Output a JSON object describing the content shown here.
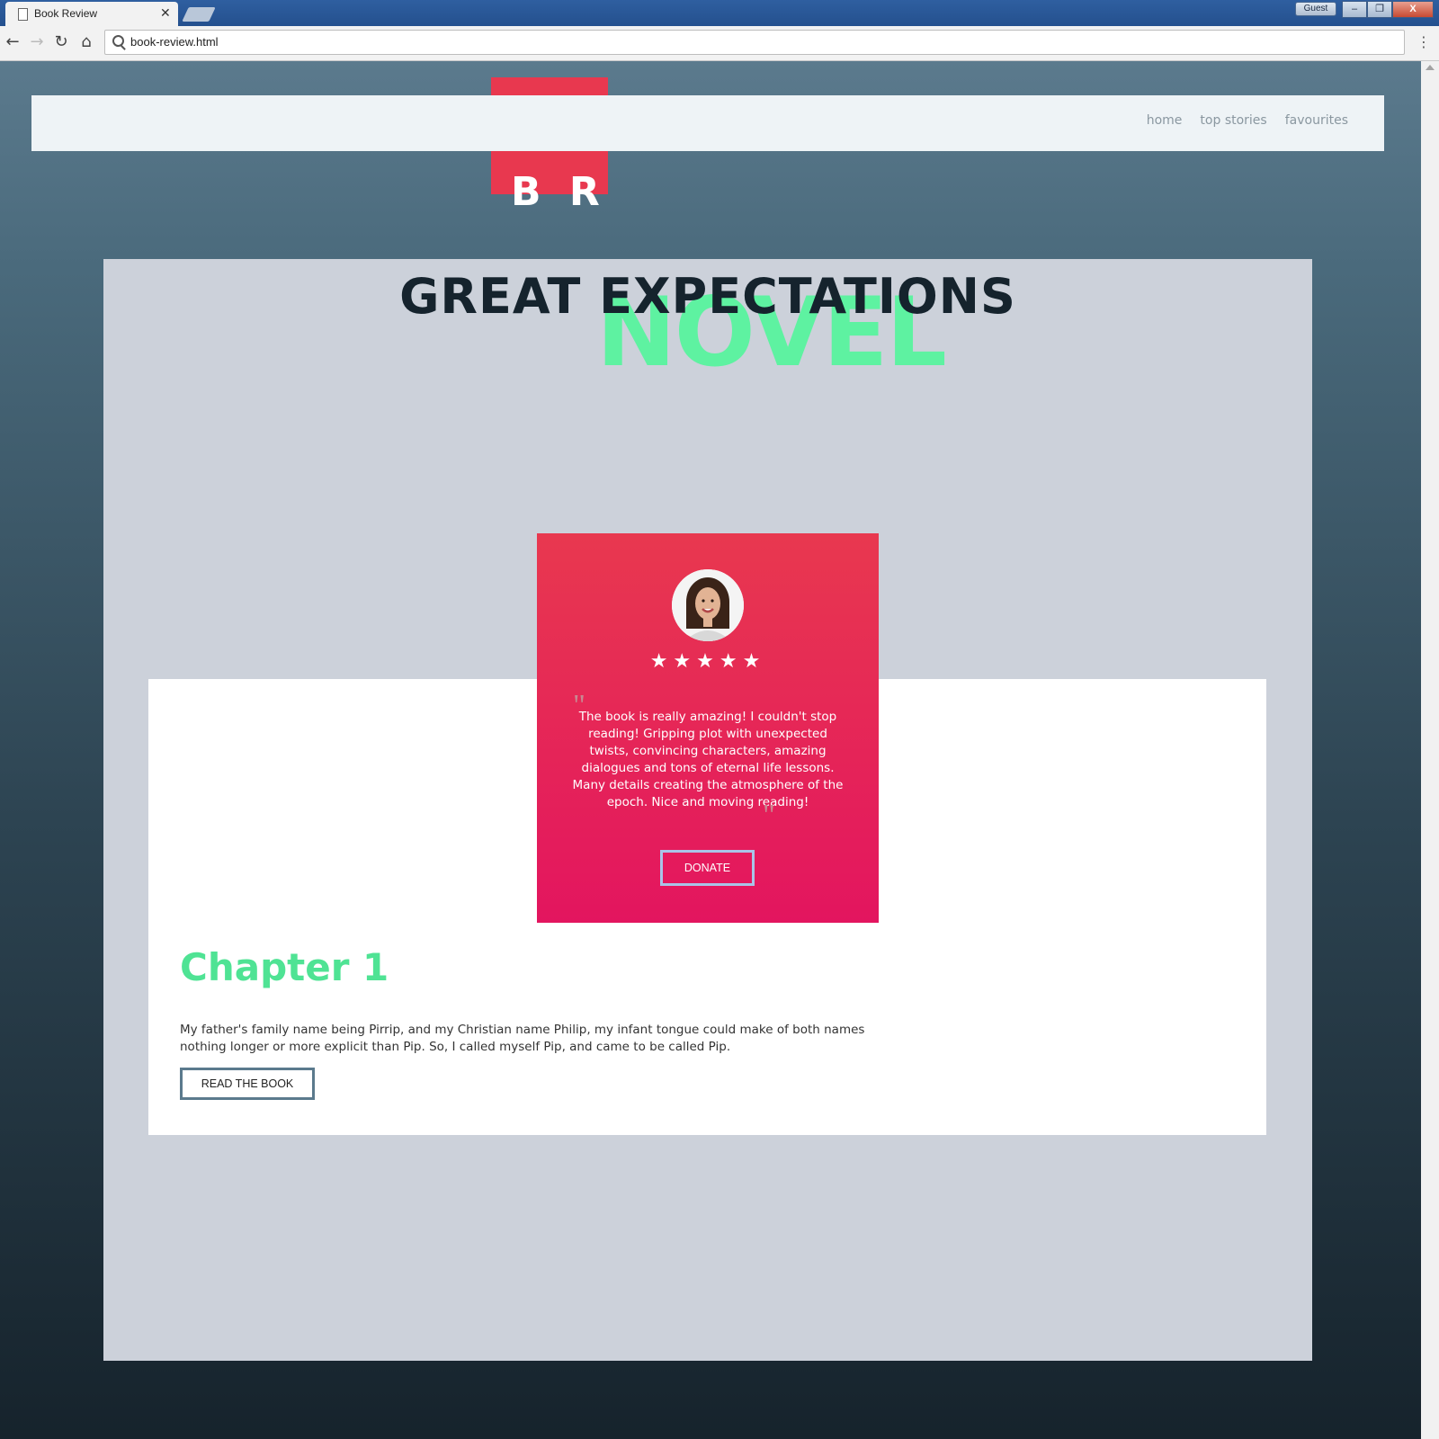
{
  "browser": {
    "tab_title": "Book Review",
    "tab_close": "✕",
    "guest_label": "Guest",
    "url": "book-review.html",
    "back_icon": "←",
    "forward_icon": "→",
    "reload_icon": "↻",
    "home_icon": "⌂",
    "menu_icon": "⋮",
    "window_buttons": [
      "–",
      "❐",
      "X"
    ]
  },
  "site": {
    "logo": "B R",
    "nav": [
      "home",
      "top stories",
      "favourites"
    ],
    "accent_color": "#e8384f",
    "green_color": "#5ef2a1"
  },
  "hero": {
    "title": "GREAT EXPECTATIONS",
    "subtitle": "NOVEL"
  },
  "review_card": {
    "stars": "★★★★★",
    "rating": 5,
    "open_quote": "\"",
    "close_quote": "\"",
    "text": "The book is really amazing! I couldn't stop reading! Gripping plot with unexpected twists, convincing characters, amazing dialogues and tons of eternal life lessons. Many details creating the atmosphere of the epoch. Nice and moving reading!",
    "button": "DONATE"
  },
  "chapter": {
    "title": "Chapter 1",
    "text": "My father's family name being Pirrip, and my Christian name Philip, my infant tongue could make of both names nothing longer or more explicit than Pip. So, I called myself Pip, and came to be called Pip.",
    "button": "READ THE BOOK"
  }
}
